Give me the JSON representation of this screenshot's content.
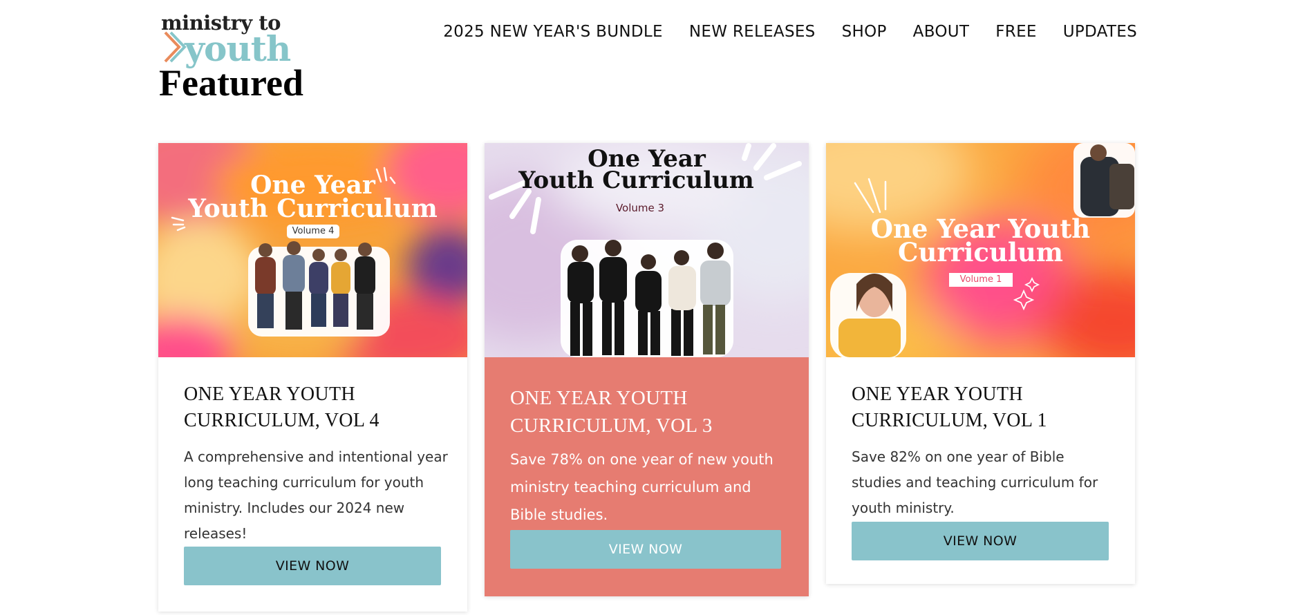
{
  "header": {
    "logo_line1": "ministry to",
    "logo_line2": "youth",
    "nav": [
      "2025 NEW YEAR'S BUNDLE",
      "NEW RELEASES",
      "SHOP",
      "ABOUT",
      "FREE",
      "UPDATES"
    ]
  },
  "page_title": "Featured",
  "colors": {
    "accent_teal": "#89c3cb",
    "card_highlight": "#e67c71",
    "logo_teal": "#86c5c9"
  },
  "cards": [
    {
      "hero_line1": "One Year",
      "hero_line2": "Youth Curriculum",
      "hero_volume": "Volume 4",
      "title": "ONE YEAR YOUTH CURRICULUM, VOL 4",
      "description": "A comprehensive and intentional year long teaching curriculum for youth ministry. Includes our 2024 new releases!",
      "button": "VIEW NOW"
    },
    {
      "hero_line1": "One Year",
      "hero_line2": "Youth Curriculum",
      "hero_volume": "Volume 3",
      "title": "ONE YEAR YOUTH CURRICULUM, VOL 3",
      "description": "Save 78% on one year of new youth ministry teaching curriculum and Bible studies.",
      "button": "VIEW NOW"
    },
    {
      "hero_line1": "One Year Youth",
      "hero_line2": "Curriculum",
      "hero_volume": "Volume 1",
      "title": "ONE YEAR YOUTH CURRICULUM, VOL 1",
      "description": "Save 82% on one year of Bible studies and teaching curriculum for youth ministry.",
      "button": "VIEW NOW"
    }
  ]
}
